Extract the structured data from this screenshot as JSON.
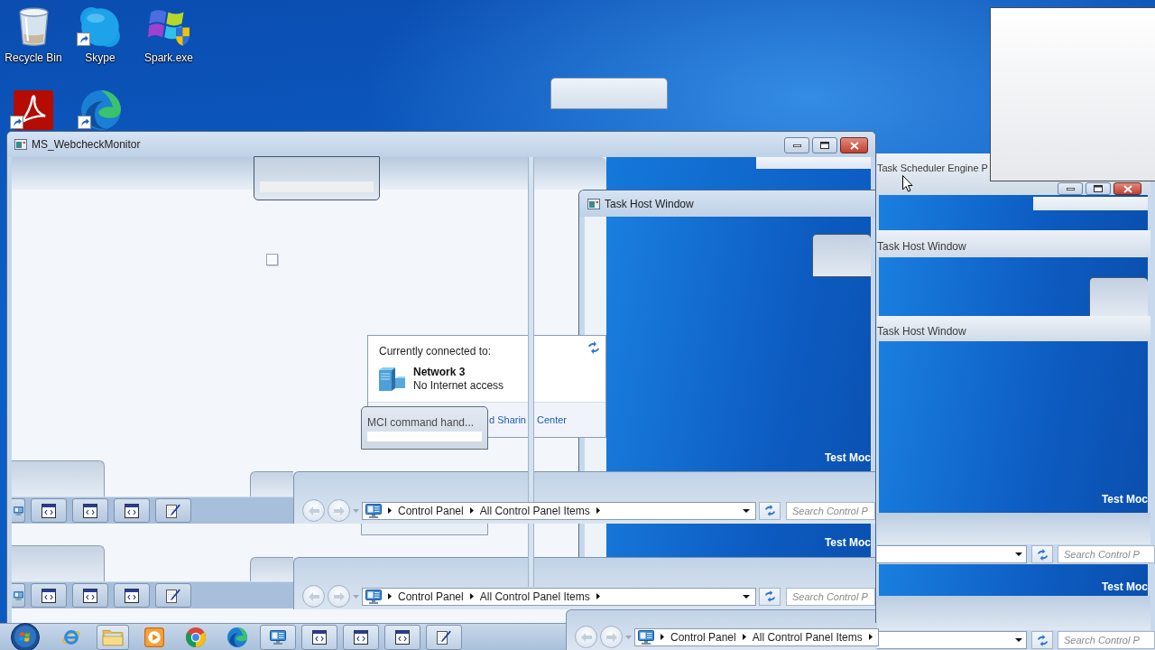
{
  "desktop_icons": [
    {
      "kind": "recycle-bin",
      "label": "Recycle Bin",
      "shortcut": false
    },
    {
      "kind": "skype",
      "label": "Skype",
      "shortcut": true
    },
    {
      "kind": "windows-flag",
      "label": "Spark.exe",
      "shortcut": false
    },
    {
      "kind": "pdf",
      "shortcut": true
    },
    {
      "kind": "edge",
      "shortcut": true
    }
  ],
  "main_window": {
    "title": "MS_WebcheckMonitor"
  },
  "network_popup": {
    "heading": "Currently connected to:",
    "network": "Network 3",
    "status": "No Internet access",
    "link_fragments": [
      "d Sharin",
      "Center"
    ]
  },
  "mci_popup": {
    "title": "MCI command hand..."
  },
  "task_host_window": {
    "title": "Task Host Window",
    "banners": [
      "Test Moc",
      "Test Moc"
    ]
  },
  "right_windows": [
    {
      "title": "Task Scheduler Engine P"
    },
    {
      "title": "Task Host Window"
    },
    {
      "title": "Task Host Window"
    }
  ],
  "right_banners": [
    "Test Moc",
    "Test Moc"
  ],
  "right_search_fields": [
    {
      "placeholder": "Search Control P"
    },
    {
      "placeholder": "Search Control P"
    }
  ],
  "taskbar_strips": [
    {
      "buttons": [
        {
          "kind": "control-panel"
        },
        {
          "kind": "app"
        },
        {
          "kind": "app"
        },
        {
          "kind": "app"
        },
        {
          "kind": "notepad"
        }
      ]
    },
    {
      "buttons": [
        {
          "kind": "control-panel"
        },
        {
          "kind": "app"
        },
        {
          "kind": "app"
        },
        {
          "kind": "app"
        },
        {
          "kind": "notepad"
        }
      ]
    }
  ],
  "explorer_bars": [
    {
      "crumbs": [
        "Control Panel",
        "All Control Panel Items"
      ],
      "search_placeholder": "Search Control P"
    },
    {
      "crumbs": [
        "Control Panel",
        "All Control Panel Items"
      ],
      "search_placeholder": "Search Control P"
    },
    {
      "crumbs": [
        "Control Panel",
        "All Control Panel Items"
      ]
    }
  ],
  "taskbar": {
    "items": [
      {
        "kind": "start"
      },
      {
        "kind": "ie",
        "running": false
      },
      {
        "kind": "explorer",
        "running": true
      },
      {
        "kind": "media-player",
        "running": false
      },
      {
        "kind": "chrome",
        "running": false
      },
      {
        "kind": "edge",
        "running": false
      },
      {
        "kind": "control-panel",
        "running": true
      },
      {
        "kind": "app",
        "running": true
      },
      {
        "kind": "app",
        "running": true
      },
      {
        "kind": "app",
        "running": true
      },
      {
        "kind": "notepad",
        "running": true
      }
    ]
  }
}
